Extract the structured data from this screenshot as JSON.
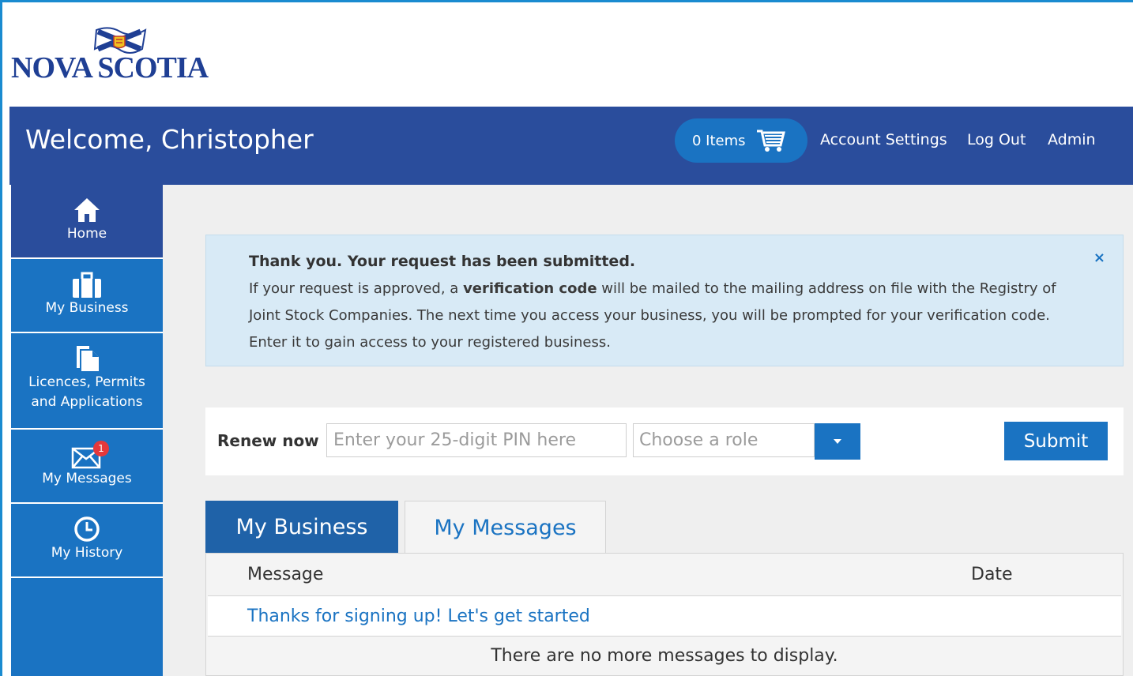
{
  "brand": {
    "name": "NOVA SCOTIA"
  },
  "header": {
    "welcome": "Welcome, Christopher",
    "cart_label": "0 Items",
    "links": [
      "Account Settings",
      "Log Out",
      "Admin"
    ]
  },
  "sidebar": {
    "items": [
      {
        "label": "Home",
        "icon": "home-icon",
        "active": true
      },
      {
        "label": "My Business",
        "icon": "briefcase-icon"
      },
      {
        "label_line1": "Licences, Permits",
        "label_line2": "and Applications",
        "icon": "document-icon"
      },
      {
        "label": "My Messages",
        "icon": "envelope-icon",
        "badge": "1"
      },
      {
        "label": "My History",
        "icon": "clock-icon"
      }
    ]
  },
  "alert": {
    "title": "Thank you. Your request has been submitted.",
    "body_pre": "If your request is approved, a ",
    "body_bold": "verification code",
    "body_post": " will be mailed to the mailing address on file with the Registry of Joint Stock Companies. The next time you access your business, you will be prompted for your verification code. Enter it to gain access to your registered business.",
    "close": "×"
  },
  "renew": {
    "label": "Renew now",
    "pin_placeholder": "Enter your 25-digit PIN here",
    "role_placeholder": "Choose a role",
    "submit_label": "Submit"
  },
  "tabs": [
    {
      "label": "My Business",
      "active": false
    },
    {
      "label": "My Messages",
      "active": true
    }
  ],
  "messages_table": {
    "columns": [
      "Message",
      "Date"
    ],
    "rows": [
      {
        "message": "Thanks for signing up! Let's get started",
        "date": ""
      }
    ],
    "empty_text": "There are no more messages to display."
  },
  "colors": {
    "header_bg": "#2a4d9c",
    "sidebar_bg": "#1a73c2",
    "accent": "#1a73c2",
    "alert_bg": "#d8eaf6",
    "badge": "#e5383b"
  }
}
